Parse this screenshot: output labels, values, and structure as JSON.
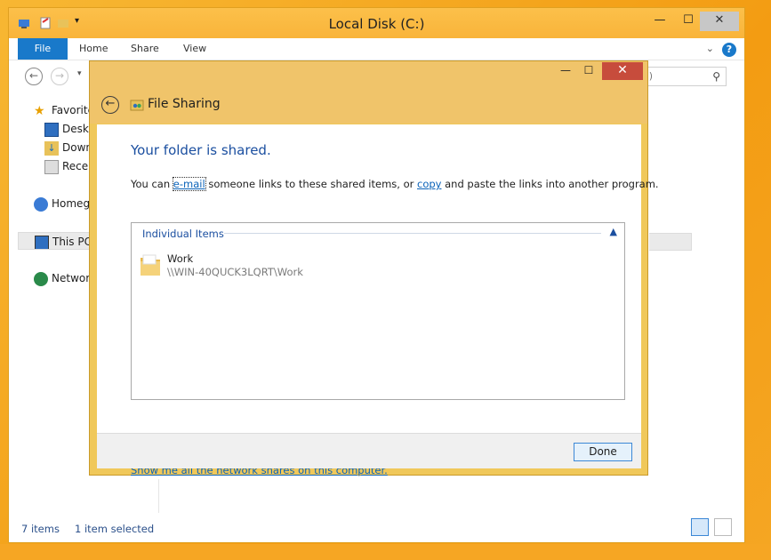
{
  "explorer": {
    "title": "Local Disk (C:)",
    "ribbon_tabs": [
      "File",
      "Home",
      "Share",
      "View"
    ],
    "help_label": "?",
    "search_placeholder": ":)",
    "nav_items": [
      {
        "label": "Favorites",
        "icon": "star-icon"
      },
      {
        "label": "Desktop",
        "icon": "desktop-icon"
      },
      {
        "label": "Downloads",
        "icon": "downloads-icon"
      },
      {
        "label": "Recent places",
        "icon": "recent-places-icon"
      },
      {
        "label": "Homegroup",
        "icon": "homegroup-icon"
      },
      {
        "label": "This PC",
        "icon": "computer-icon",
        "selected": true
      },
      {
        "label": "Network",
        "icon": "network-icon"
      }
    ],
    "status": {
      "items": "7 items",
      "selected": "1 item selected"
    }
  },
  "dialog": {
    "title": "File Sharing",
    "heading": "Your folder is shared.",
    "desc_before": "You can ",
    "email_link": "e-mail",
    "desc_middle": " someone links to these shared items, or ",
    "copy_link": "copy",
    "desc_after": " and paste the links into another program.",
    "group_header": "Individual Items",
    "item": {
      "name": "Work",
      "path": "\\\\WIN-40QUCK3LQRT\\Work"
    },
    "shares_link": "Show me all the network shares on this computer.",
    "done_label": "Done"
  },
  "colors": {
    "accent": "#1979ca",
    "heading": "#1b4fa0",
    "link": "#0b63b9",
    "frame": "#f0c46a"
  }
}
